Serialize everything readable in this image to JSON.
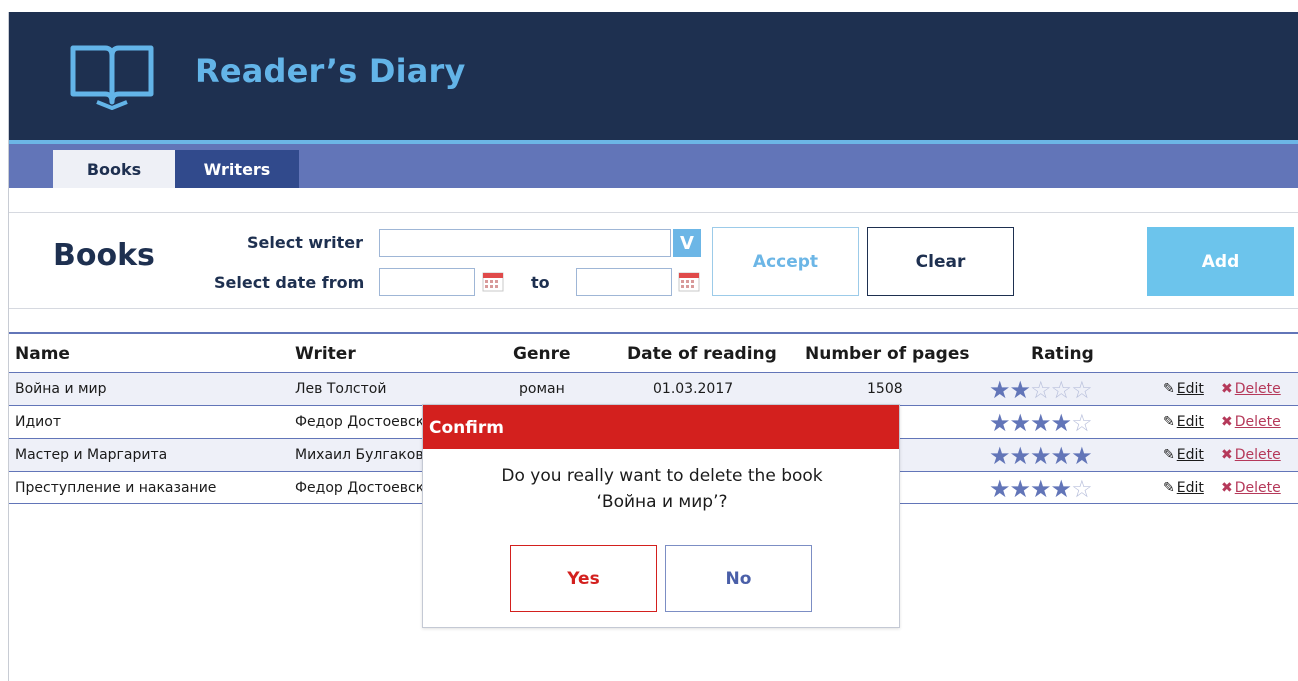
{
  "app": {
    "title": "Reader’s Diary"
  },
  "tabs": [
    {
      "label": "Books",
      "active": true
    },
    {
      "label": "Writers",
      "active": false
    }
  ],
  "filters": {
    "page_title": "Books",
    "writer_label": "Select writer",
    "writer_value": "",
    "date_from_label": "Select date from",
    "date_from_value": "",
    "to_label": "to",
    "date_to_value": "",
    "dropdown_glyph": "V"
  },
  "buttons": {
    "accept": "Accept",
    "clear": "Clear",
    "add": "Add"
  },
  "table": {
    "columns": [
      "Name",
      "Writer",
      "Genre",
      "Date of reading",
      "Number of pages",
      "Rating"
    ],
    "edit_label": "Edit",
    "delete_label": "Delete",
    "rows": [
      {
        "name": "Война и мир",
        "writer": "Лев Толстой",
        "genre": "роман",
        "date": "01.03.2017",
        "pages": "1508",
        "rating": 2
      },
      {
        "name": "Идиот",
        "writer": "Федор Достоевский",
        "genre": "",
        "date": "",
        "pages": "",
        "rating": 4
      },
      {
        "name": "Мастер и Маргарита",
        "writer": "Михаил Булгаков",
        "genre": "",
        "date": "",
        "pages": "",
        "rating": 5
      },
      {
        "name": "Преступление и наказание",
        "writer": "Федор Достоевский",
        "genre": "",
        "date": "",
        "pages": "",
        "rating": 4
      }
    ],
    "rating_max": 5
  },
  "dialog": {
    "title": "Confirm",
    "message_line1": "Do you really want to delete the book",
    "message_line2": "‘Война и мир’?",
    "yes_label": "Yes",
    "no_label": "No"
  },
  "colors": {
    "header_bg": "#1e3050",
    "accent_blue": "#6cb6e6",
    "tab_bar": "#6275b8",
    "confirm_red": "#d3201e",
    "delete_red": "#b5395a"
  },
  "icons": {
    "logo": "open-book-icon",
    "dropdown": "chevron-down-icon",
    "calendar": "calendar-icon",
    "edit": "pencil-icon",
    "delete": "x-icon",
    "rating": "star-icon"
  }
}
